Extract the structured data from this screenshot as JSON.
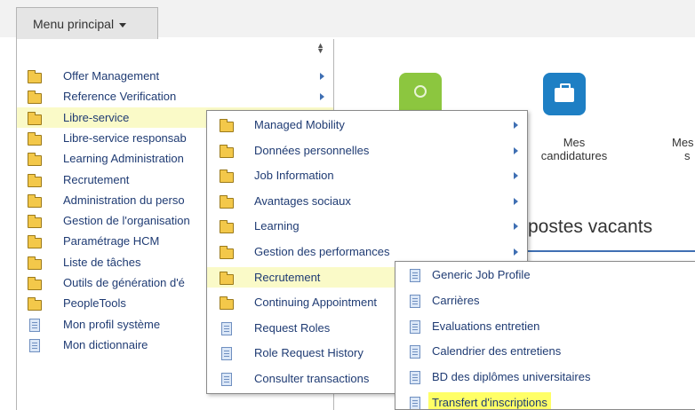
{
  "menu_button": {
    "label": "Menu principal"
  },
  "main_menu": {
    "items": [
      {
        "label": "Offer Management",
        "type": "folder",
        "has_submenu": true
      },
      {
        "label": "Reference Verification",
        "type": "folder",
        "has_submenu": true
      },
      {
        "label": "Libre-service",
        "type": "folder",
        "has_submenu": true,
        "highlighted": true
      },
      {
        "label": "Libre-service responsab",
        "type": "folder",
        "has_submenu": true
      },
      {
        "label": "Learning Administration",
        "type": "folder",
        "has_submenu": true
      },
      {
        "label": "Recrutement",
        "type": "folder",
        "has_submenu": true
      },
      {
        "label": "Administration du perso",
        "type": "folder",
        "has_submenu": true
      },
      {
        "label": "Gestion de l'organisation",
        "type": "folder",
        "has_submenu": true
      },
      {
        "label": "Paramétrage HCM",
        "type": "folder",
        "has_submenu": true
      },
      {
        "label": "Liste de tâches",
        "type": "folder",
        "has_submenu": true
      },
      {
        "label": "Outils de génération d'é",
        "type": "folder",
        "has_submenu": true
      },
      {
        "label": "PeopleTools",
        "type": "folder",
        "has_submenu": true
      },
      {
        "label": "Mon profil système",
        "type": "document",
        "has_submenu": false
      },
      {
        "label": "Mon dictionnaire",
        "type": "document",
        "has_submenu": false
      }
    ]
  },
  "submenu_libre_service": {
    "items": [
      {
        "label": "Managed Mobility",
        "type": "folder",
        "has_submenu": true
      },
      {
        "label": "Données personnelles",
        "type": "folder",
        "has_submenu": true
      },
      {
        "label": "Job Information",
        "type": "folder",
        "has_submenu": true
      },
      {
        "label": "Avantages sociaux",
        "type": "folder",
        "has_submenu": true
      },
      {
        "label": "Learning",
        "type": "folder",
        "has_submenu": true
      },
      {
        "label": "Gestion des performances",
        "type": "folder",
        "has_submenu": true
      },
      {
        "label": "Recrutement",
        "type": "folder",
        "has_submenu": true,
        "highlighted": true
      },
      {
        "label": "Continuing Appointment",
        "type": "folder",
        "has_submenu": true
      },
      {
        "label": "Request Roles",
        "type": "document",
        "has_submenu": false
      },
      {
        "label": "Role Request History",
        "type": "document",
        "has_submenu": false
      },
      {
        "label": "Consulter transactions",
        "type": "document",
        "has_submenu": false
      }
    ]
  },
  "submenu_recrutement": {
    "items": [
      {
        "label": "Generic Job Profile",
        "type": "document"
      },
      {
        "label": "Carrières",
        "type": "document"
      },
      {
        "label": "Evaluations entretien",
        "type": "document"
      },
      {
        "label": "Calendrier des entretiens",
        "type": "document"
      },
      {
        "label": "BD des diplômes universitaires",
        "type": "document"
      },
      {
        "label": "Transfert d'inscriptions",
        "type": "document",
        "highlighted": true
      }
    ]
  },
  "tiles": {
    "blue_label_line1": "Mes",
    "blue_label_line2": "candidatures",
    "partial_label_line1": "Mes",
    "partial_label_line2": "s"
  },
  "section_heading": "postes vacants",
  "colors": {
    "highlight": "#fafac8",
    "selected_highlight": "#ffff66",
    "link": "#1f3b73",
    "tile_green": "#8cc63f",
    "tile_blue": "#1e7fc4"
  }
}
